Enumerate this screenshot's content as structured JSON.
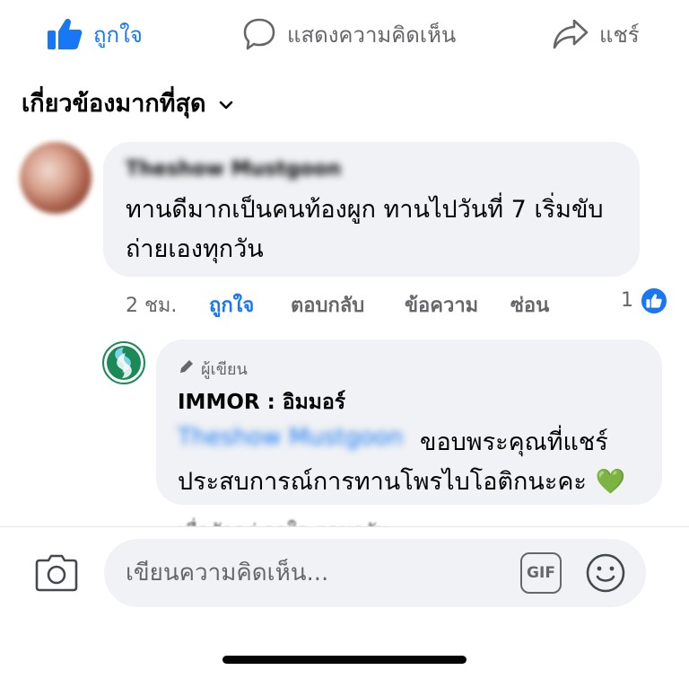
{
  "actions": {
    "like_label": "ถูกใจ",
    "comment_label": "แสดงความคิดเห็น",
    "share_label": "แชร์"
  },
  "sort": {
    "label": "เกี่ยวข้องมากที่สุด"
  },
  "comment": {
    "author": "Theshow Mustgoon",
    "text": "ทานดีมากเป็นคนท้องผูก ทานไปวันที่ 7 เริ่มขับถ่ายเองทุกวัน",
    "time": "2 ชม.",
    "like": "ถูกใจ",
    "reply": "ตอบกลับ",
    "message": "ข้อความ",
    "hide": "ซ่อน",
    "like_count": "1"
  },
  "reply": {
    "badge": "ผู้เขียน",
    "author": "IMMOR : อิมมอร์",
    "mention": "Theshow Mustgoon",
    "text_line1": "ขอบพระคุณที่แชร์",
    "text_line2": "ประสบการณ์การทานโพรไบโอติกนะคะ",
    "emoji": "💚",
    "meta": "เมื่อสักครู่ ถูกใจ ตอบกลับ"
  },
  "composer": {
    "placeholder": "เขียนความคิดเห็น...",
    "gif_label": "GIF"
  },
  "colors": {
    "accent": "#1877f2",
    "bubble": "#f0f2f5",
    "muted": "#65676b"
  }
}
